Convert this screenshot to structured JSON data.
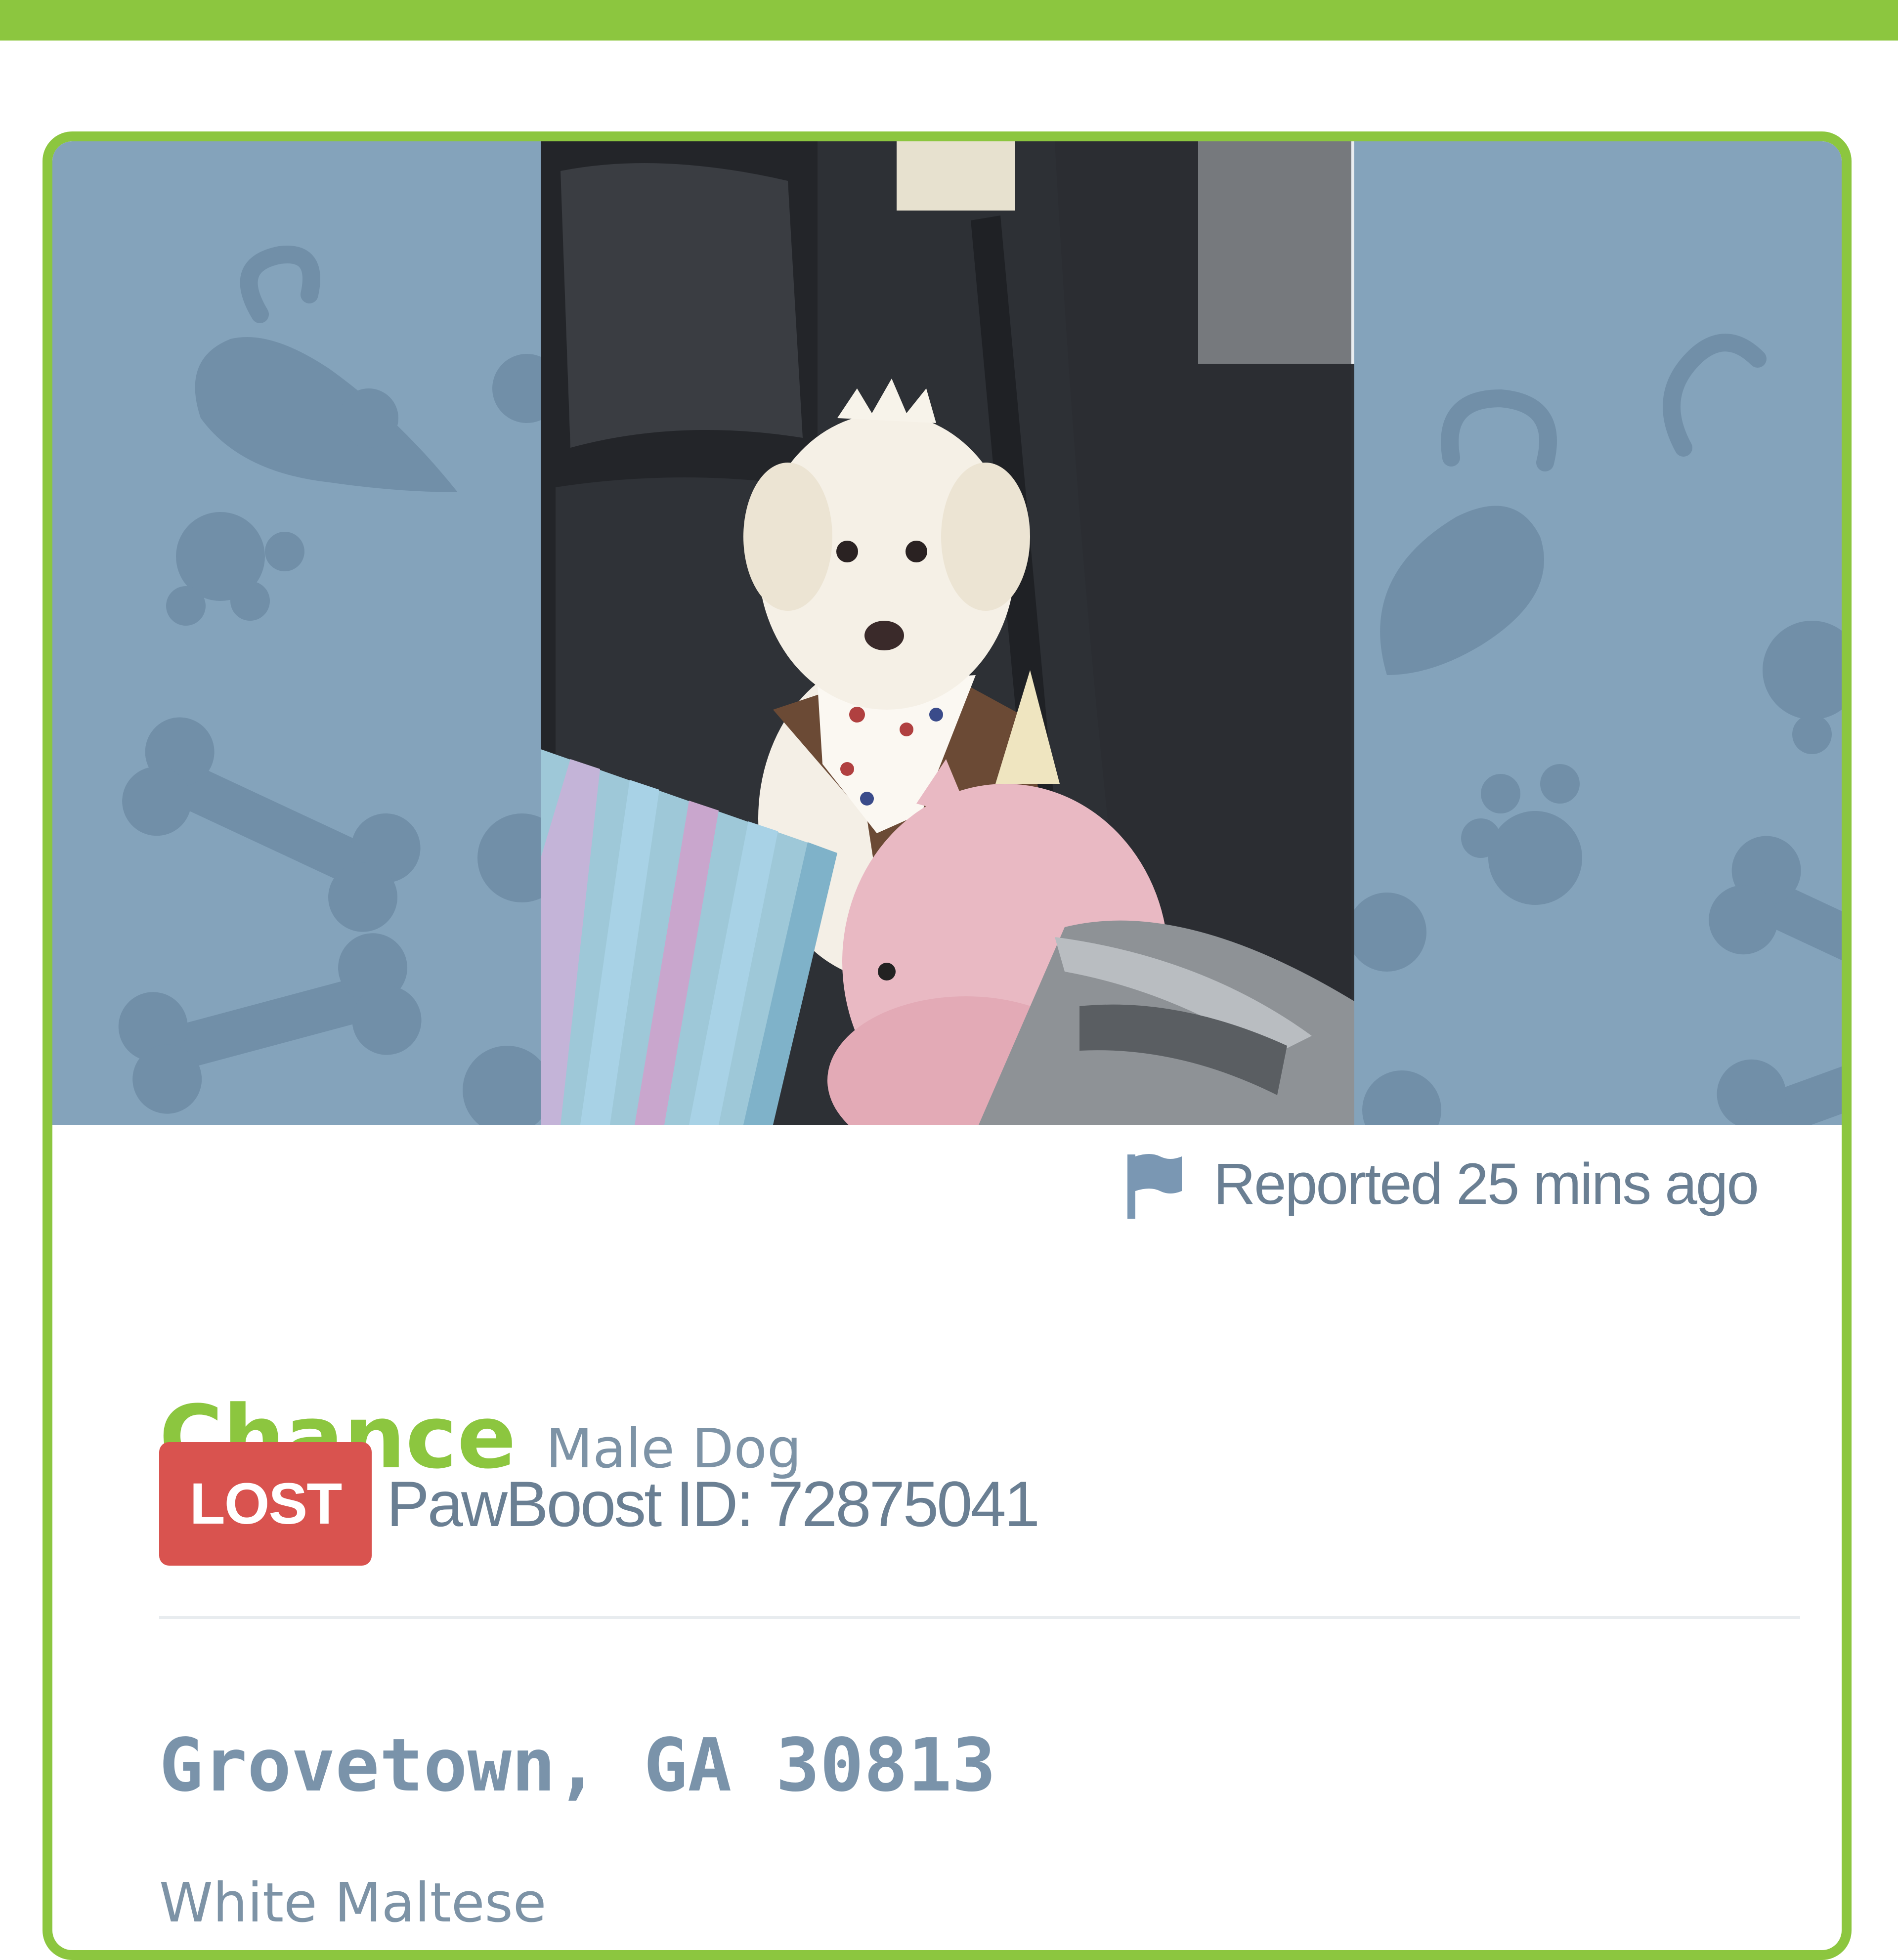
{
  "header": {
    "accent_color": "#8cc63f"
  },
  "listing": {
    "reported": "Reported 25 mins ago",
    "name": "Chance",
    "description": "Male Dog",
    "status": "LOST",
    "pawboost_id": "PawBoost ID: 72875041",
    "location": "Grovetown, GA 30813",
    "breed": "White Maltese",
    "photo_icon": "pet-photo",
    "report_icon": "flag-icon"
  },
  "colors": {
    "brand_green": "#8cc63f",
    "lost_red": "#d9534f",
    "text_slate": "#6a7f93",
    "hero_blue": "#84a3bb"
  }
}
